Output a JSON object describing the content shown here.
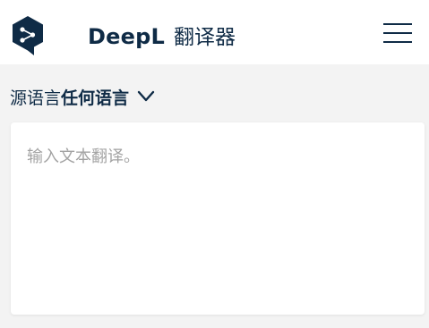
{
  "header": {
    "brand_name": "DeepL",
    "brand_sub": "翻译器",
    "logo_icon": "deepl-logo-icon",
    "menu_icon": "hamburger-menu-icon",
    "logo_color": "#0f2b46"
  },
  "source_language": {
    "label": "源语言",
    "value": "任何语言",
    "chevron_icon": "chevron-down-icon"
  },
  "input": {
    "value": "",
    "placeholder": "输入文本翻译。"
  }
}
